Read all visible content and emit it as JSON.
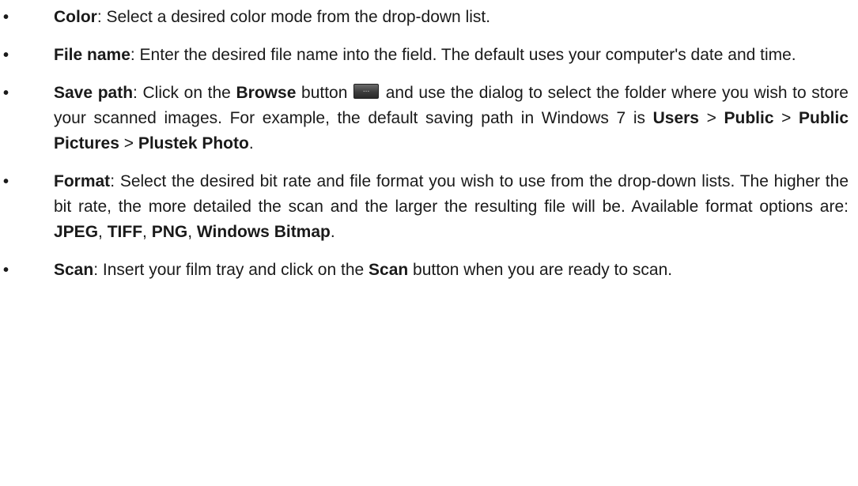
{
  "bullet_glyph": "•",
  "items": [
    {
      "term": "Color",
      "sep": ": ",
      "text": "Select a desired color mode from the drop-down list."
    },
    {
      "term": "File name",
      "sep": ": ",
      "text": "Enter the desired file name into the field. The default uses your computer's date and time."
    },
    {
      "term": "Save path",
      "sep": ": ",
      "text_a": "Click on the ",
      "bold_browse": "Browse",
      "text_b": " button",
      "browse_icon": "ellipsis-button-icon",
      "browse_dots": "...",
      "text_c": " and use the dialog to select the folder where you wish to store your scanned images. For example, the default saving path in Windows 7 is ",
      "path_1": "Users",
      "path_sep": " > ",
      "path_2": "Public",
      "path_3": "Public Pictures",
      "path_4": "Plustek Photo",
      "end": "."
    },
    {
      "term": "Format",
      "sep": ": ",
      "text": "Select the desired bit rate and file format you wish to use from the drop-down lists. The higher the bit rate, the more detailed the scan and the larger the resulting file will be. Available format options are: ",
      "fmt_1": "JPEG",
      "comma": ", ",
      "fmt_2": "TIFF",
      "fmt_3": "PNG",
      "fmt_4": "Windows Bitmap",
      "end": "."
    },
    {
      "term": "Scan",
      "sep": ": ",
      "text_a": "Insert your film tray and click on the ",
      "bold_scan": "Scan",
      "text_b": " button when you are ready to scan."
    }
  ]
}
